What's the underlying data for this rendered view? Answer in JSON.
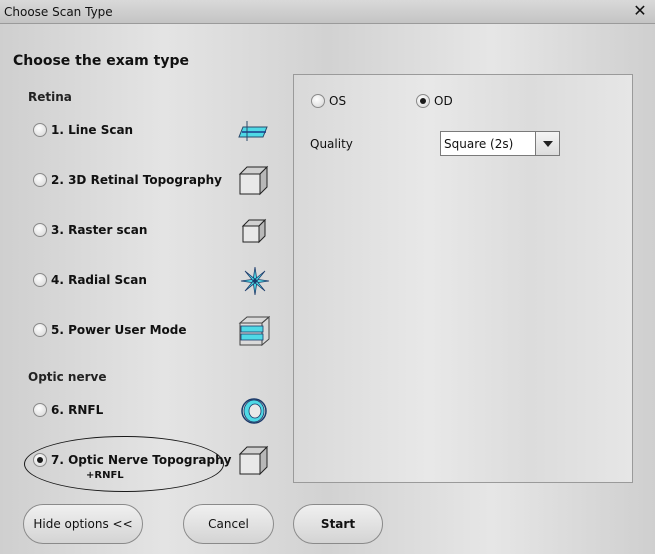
{
  "window": {
    "title": "Choose Scan Type",
    "close_glyph": "✕"
  },
  "heading": "Choose the exam type",
  "sections": {
    "retina": "Retina",
    "optic_nerve": "Optic nerve"
  },
  "scan_types": [
    {
      "label": "1. Line Scan",
      "icon": "line-scan-icon",
      "selected": false
    },
    {
      "label": "2. 3D Retinal Topography",
      "icon": "cube-icon",
      "selected": false
    },
    {
      "label": "3. Raster scan",
      "icon": "small-cube-icon",
      "selected": false
    },
    {
      "label": "4. Radial Scan",
      "icon": "radial-scan-icon",
      "selected": false
    },
    {
      "label": "5. Power User Mode",
      "icon": "power-user-icon",
      "selected": false
    },
    {
      "label": "6. RNFL",
      "icon": "rnfl-icon",
      "selected": false
    },
    {
      "label": "7. Optic Nerve Topography",
      "sublabel": "+RNFL",
      "icon": "cube-icon",
      "selected": true
    }
  ],
  "options": {
    "eye": [
      {
        "label": "OS",
        "selected": false
      },
      {
        "label": "OD",
        "selected": true
      }
    ],
    "quality_label": "Quality",
    "quality_value": "Square (2s)"
  },
  "buttons": {
    "hide_options": "Hide options <<",
    "cancel": "Cancel",
    "start": "Start"
  },
  "colors": {
    "accent_cyan": "#33e0e0",
    "ellipse_outline": "#1a1a1a"
  }
}
